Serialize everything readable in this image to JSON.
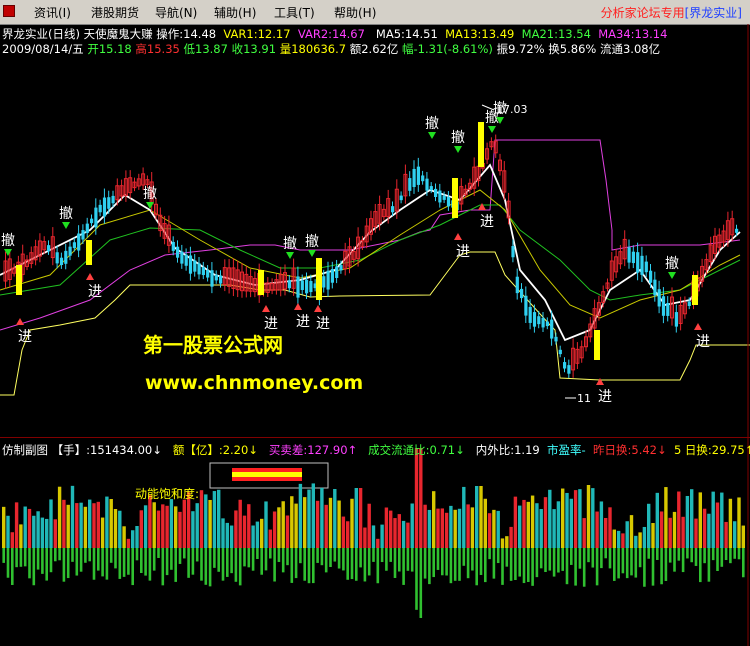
{
  "menu": {
    "items": [
      "资讯(I)",
      "港股期货",
      "导航(N)",
      "辅助(H)",
      "工具(T)",
      "帮助(H)"
    ],
    "forum_note": "分析家论坛专用",
    "company": "[界龙实业]"
  },
  "indicator_row": {
    "title": "界龙实业(日线) 天使魔鬼大赚",
    "op_label": "操作:14.48",
    "var1": "VAR1:12.17",
    "var2": "VAR2:14.67",
    "ma5": "MA5:14.51",
    "ma13": "MA13:13.49",
    "ma21": "MA21:13.54",
    "ma34": "MA34:13.14"
  },
  "quote_row": {
    "date": "2009/08/14/五",
    "open": "开15.18",
    "high": "高15.35",
    "low": "低13.87",
    "close": "收13.91",
    "volume": "量180636.7",
    "amount": "额2.62亿",
    "change": "幅-1.31(-8.61%)",
    "amplitude": "振9.72%",
    "turnover": "换5.86%",
    "float": "流通3.08亿"
  },
  "chart": {
    "price_high_label": "17.03",
    "price_low_label": "11",
    "buy_text": "进",
    "sell_text": "撤",
    "watermark_cn": "第一股票公式网",
    "watermark_url": "www.chnmoney.com",
    "colors": {
      "up": "#e8262e",
      "down": "#30d0f0",
      "signal": "#ffff00",
      "ma5": "#ffffff",
      "ma13": "#c8c800",
      "ma21": "#20c020",
      "ma34": "#e040e0",
      "stop": "#ffff60"
    }
  },
  "sub_row": {
    "title": "仿制副图",
    "shou": "【手】:151434.00↓",
    "e": "额【亿】:2.20↓",
    "maimai": "买卖差:127.90↑",
    "liutong": "成交流通比:0.71↓",
    "neiwai": "内外比:1.19",
    "pe": "市盈率-",
    "zuori": "昨日换:5.42↓",
    "wuri": "5 日换:29.75↑",
    "energy_label": "动能饱和度:"
  }
}
